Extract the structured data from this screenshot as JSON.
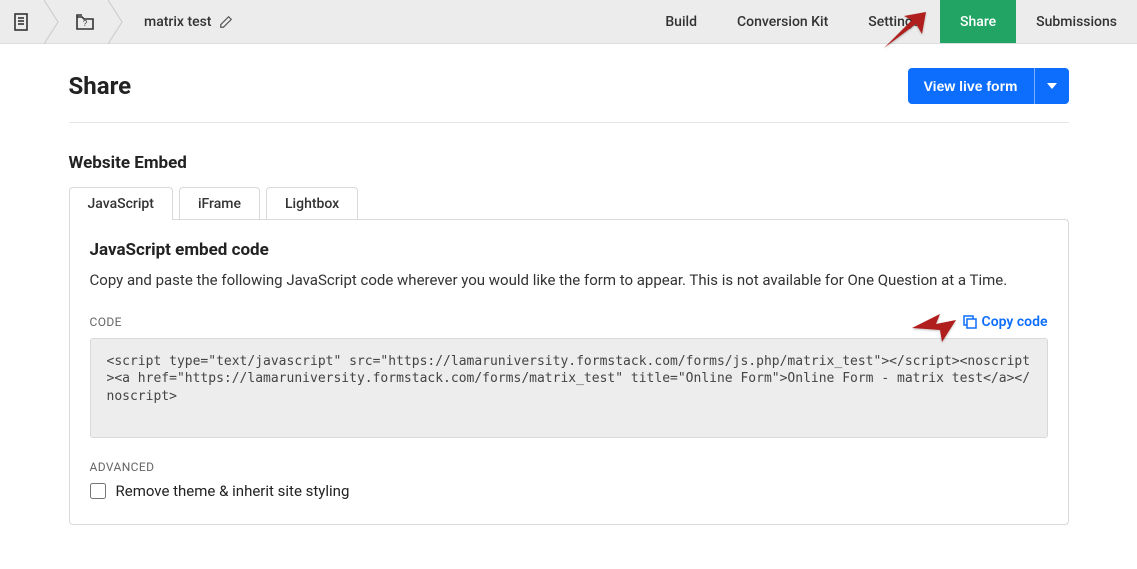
{
  "breadcrumb": {
    "form_name": "matrix test"
  },
  "nav": {
    "items": [
      "Build",
      "Conversion Kit",
      "Settings",
      "Share",
      "Submissions"
    ],
    "active_index": 3
  },
  "page": {
    "title": "Share",
    "view_live_label": "View live form"
  },
  "embed": {
    "section_title": "Website Embed",
    "tabs": [
      "JavaScript",
      "iFrame",
      "Lightbox"
    ],
    "active_tab_index": 0,
    "panel_title": "JavaScript embed code",
    "panel_desc": "Copy and paste the following JavaScript code wherever you would like the form to appear. This is not available for One Question at a Time.",
    "code_label": "CODE",
    "copy_label": "Copy code",
    "code": "<script type=\"text/javascript\" src=\"https://lamaruniversity.formstack.com/forms/js.php/matrix_test\"></script><noscript><a href=\"https://lamaruniversity.formstack.com/forms/matrix_test\" title=\"Online Form\">Online Form - matrix test</a></noscript>",
    "advanced_label": "ADVANCED",
    "advanced_option": "Remove theme & inherit site styling"
  }
}
